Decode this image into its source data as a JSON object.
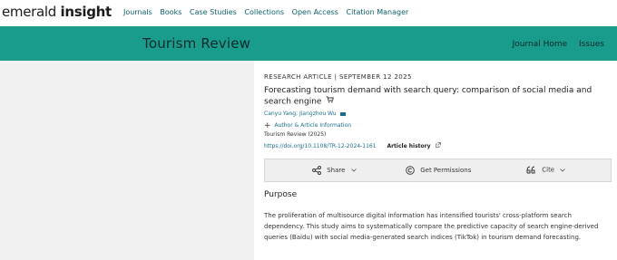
{
  "site": {
    "logo_part1": "emerald ",
    "logo_part2": "insight",
    "nav": [
      "Journals",
      "Books",
      "Case Studies",
      "Collections",
      "Open Access",
      "Citation Manager"
    ]
  },
  "journal": {
    "title": "Tourism Review",
    "links": [
      "Journal Home",
      "Issues"
    ]
  },
  "article": {
    "type": "RESEARCH ARTICLE",
    "separator": "|",
    "date": "SEPTEMBER 12 2025",
    "title": "Forecasting tourism demand with search query: comparison of social media and search engine",
    "authors": "Canyu Yang; Jiangzhou Wu",
    "author_info_label": "Author & Article Information",
    "journal_year": "Tourism Review (2025)",
    "doi": "https://doi.org/10.1108/TR-12-2024-1161",
    "article_history_label": "Article history"
  },
  "actions": {
    "share": "Share",
    "permissions": "Get Permissions",
    "cite": "Cite"
  },
  "abstract": {
    "heading": "Purpose",
    "text": "The proliferation of multisource digital information has intensified tourists' cross-platform search dependency. This study aims to systematically compare the predictive capacity of search engine-derived queries (Baidu) with social media-generated search indices (TikTok) in tourism demand forecasting."
  },
  "colors": {
    "banner": "#1a9c8c",
    "link": "#1c6e8c",
    "nav_link": "#0c5f66"
  }
}
